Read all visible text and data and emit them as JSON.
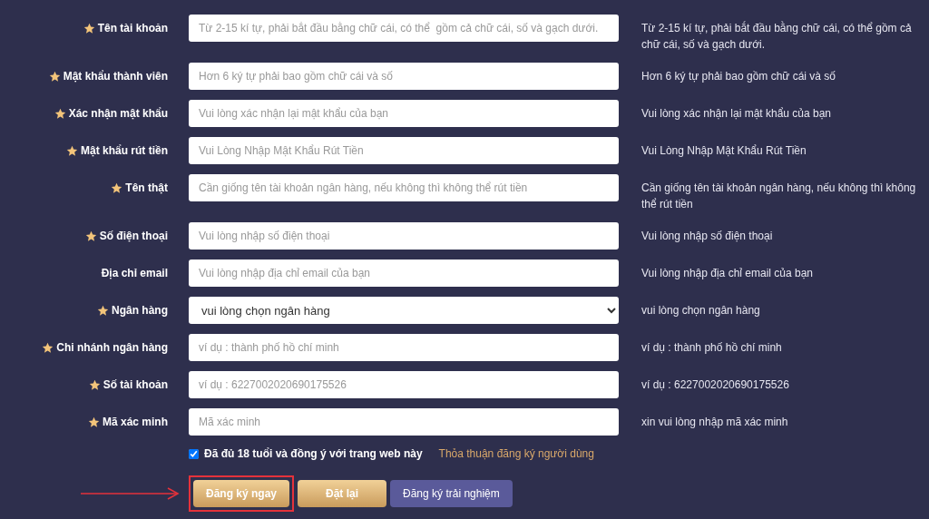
{
  "fields": [
    {
      "label": "Tên tài khoản",
      "required": true,
      "kind": "input",
      "placeholder": "Từ 2-15 kí tự, phải bắt đầu bằng chữ cái, có thể  gồm cả chữ cái, số và gạch dưới.",
      "hint": "Từ 2-15 kí tự, phải bắt đầu bằng chữ cái, có thể gồm cả chữ cái, số và gạch dưới."
    },
    {
      "label": "Mật khẩu thành viên",
      "required": true,
      "kind": "input",
      "placeholder": "Hơn 6 ký tự phải bao gồm chữ cái và số",
      "hint": "Hơn 6 ký tự phải bao gồm chữ cái và số"
    },
    {
      "label": "Xác nhận mật khẩu",
      "required": true,
      "kind": "input",
      "placeholder": "Vui lòng xác nhận lại mật khẩu của bạn",
      "hint": "Vui lòng xác nhận lại mật khẩu của bạn"
    },
    {
      "label": "Mật khẩu rút tiền",
      "required": true,
      "kind": "input",
      "placeholder": "Vui Lòng Nhập Mật Khẩu Rút Tiền",
      "hint": "Vui Lòng Nhập Mật Khẩu Rút Tiền"
    },
    {
      "label": "Tên thật",
      "required": true,
      "kind": "input",
      "placeholder": "Cần giống tên tài khoản ngân hàng, nếu không thì không thể rút tiền",
      "hint": "Cần giống tên tài khoản ngân hàng, nếu không thì không thể rút tiền"
    },
    {
      "label": "Số điện thoại",
      "required": true,
      "kind": "input",
      "placeholder": "Vui lòng nhập số điện thoại",
      "hint": "Vui lòng nhập số điện thoại"
    },
    {
      "label": "Địa chỉ email",
      "required": false,
      "kind": "input",
      "placeholder": "Vui lòng nhập địa chỉ email của bạn",
      "hint": "Vui lòng nhập địa chỉ email của bạn"
    },
    {
      "label": "Ngân hàng",
      "required": true,
      "kind": "select",
      "value": "vui lòng chọn ngân hàng",
      "hint": "vui lòng chọn ngân hàng"
    },
    {
      "label": "Chi nhánh ngân hàng",
      "required": true,
      "kind": "input",
      "placeholder": "ví dụ : thành phố hồ chí minh",
      "hint": "ví dụ : thành phố hồ chí minh"
    },
    {
      "label": "Số tài khoản",
      "required": true,
      "kind": "input",
      "placeholder": "ví dụ : 6227002020690175526",
      "hint": "ví dụ : 6227002020690175526"
    },
    {
      "label": "Mã xác minh",
      "required": true,
      "kind": "input",
      "placeholder": "Mã xác minh",
      "hint": "xin vui lòng nhập mã xác minh"
    }
  ],
  "agreement": {
    "checked": true,
    "text": "Đã đủ 18 tuổi và đồng ý với trang web này",
    "link": "Thỏa thuận đăng ký người dùng"
  },
  "buttons": [
    {
      "label": "Đăng ký ngay",
      "kind": "gold",
      "highlighted": true
    },
    {
      "label": "Đặt lại",
      "kind": "gold",
      "highlighted": false
    },
    {
      "label": "Đăng ký trải nghiệm",
      "kind": "purple",
      "highlighted": false
    }
  ]
}
